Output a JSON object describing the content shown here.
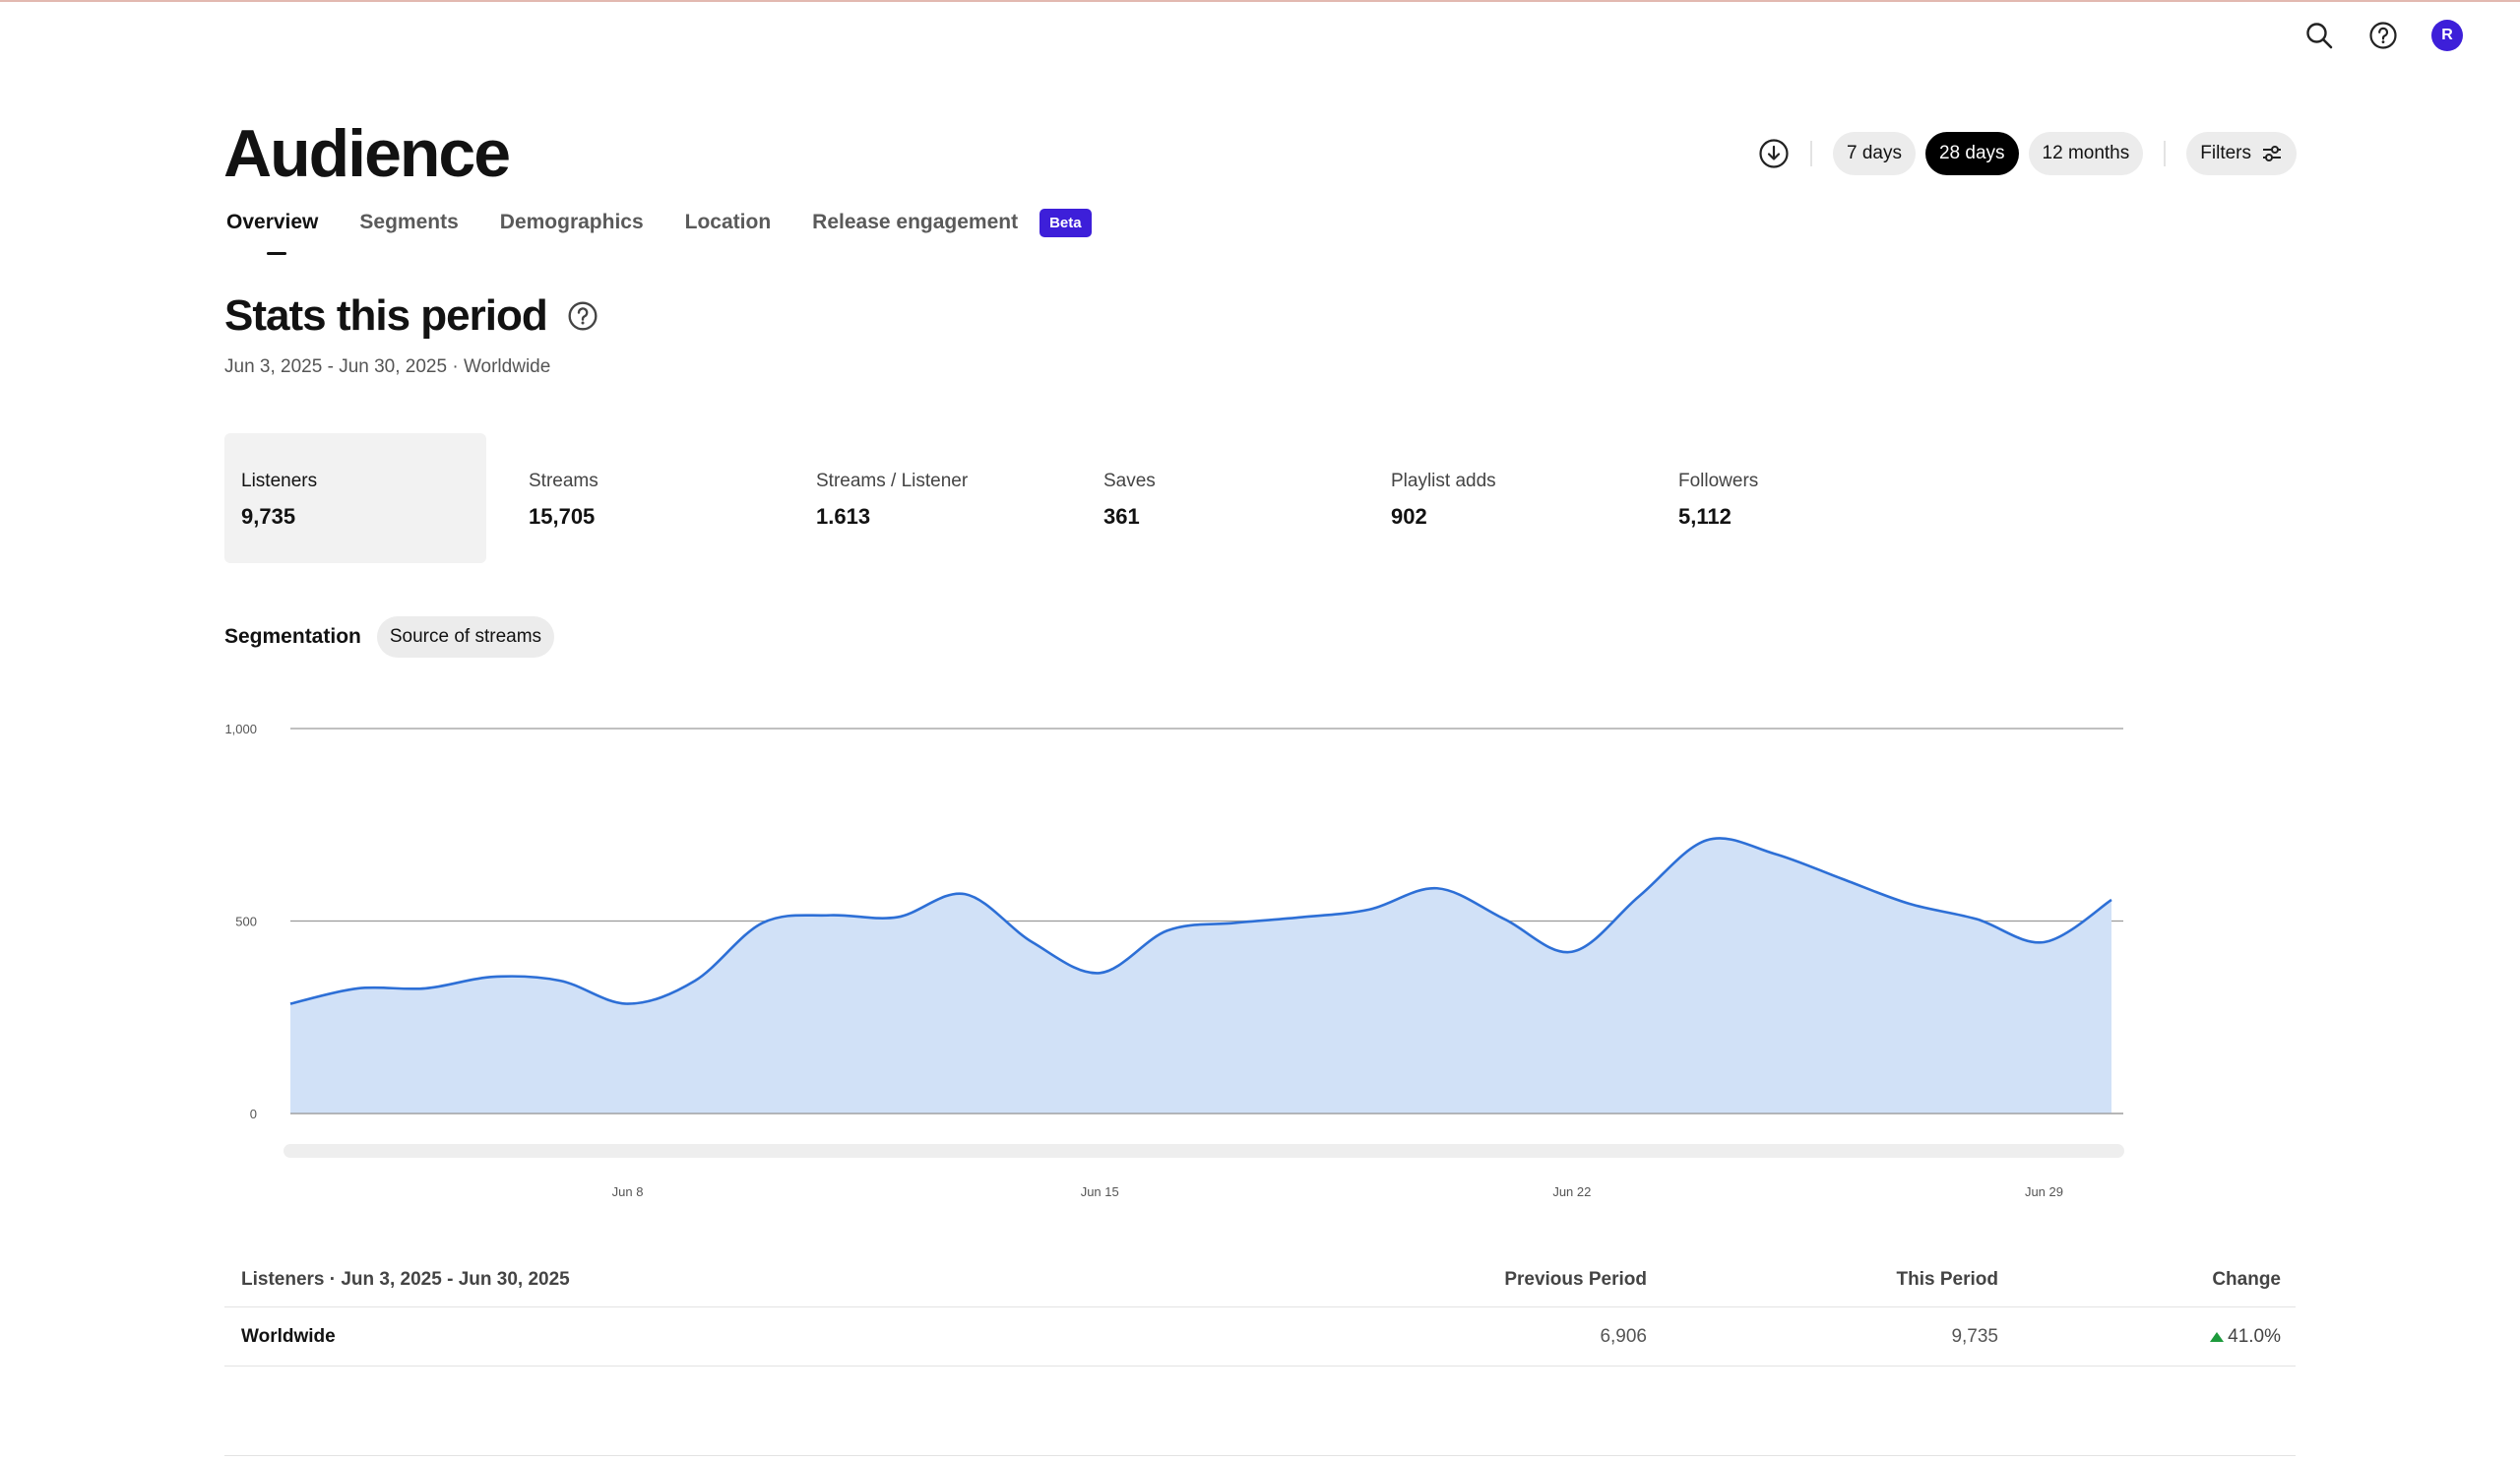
{
  "header": {
    "icons": [
      "search-icon",
      "help-icon"
    ],
    "avatar_initial": "R",
    "avatar_color": "#3d1fd9"
  },
  "page": {
    "title": "Audience"
  },
  "tabs": [
    {
      "label": "Overview",
      "active": true
    },
    {
      "label": "Segments",
      "active": false
    },
    {
      "label": "Demographics",
      "active": false
    },
    {
      "label": "Location",
      "active": false
    },
    {
      "label": "Release engagement",
      "active": false
    }
  ],
  "beta_badge": "Beta",
  "controls": {
    "download_icon": "download-icon",
    "periods": [
      "7 days",
      "28 days",
      "12 months"
    ],
    "active_period": "28 days",
    "filters_label": "Filters"
  },
  "stats_section": {
    "title": "Stats this period",
    "subtitle": "Jun 3, 2025 - Jun 30, 2025 · Worldwide"
  },
  "stats": [
    {
      "label": "Listeners",
      "value": "9,735",
      "selected": true
    },
    {
      "label": "Streams",
      "value": "15,705",
      "selected": false
    },
    {
      "label": "Streams / Listener",
      "value": "1.613",
      "selected": false
    },
    {
      "label": "Saves",
      "value": "361",
      "selected": false
    },
    {
      "label": "Playlist adds",
      "value": "902",
      "selected": false
    },
    {
      "label": "Followers",
      "value": "5,112",
      "selected": false
    }
  ],
  "segmentation": {
    "label": "Segmentation",
    "chip": "Source of streams"
  },
  "chart_data": {
    "type": "area",
    "title": "",
    "xlabel": "",
    "ylabel": "",
    "x": [
      "Jun 3",
      "Jun 4",
      "Jun 5",
      "Jun 6",
      "Jun 7",
      "Jun 8",
      "Jun 9",
      "Jun 10",
      "Jun 11",
      "Jun 12",
      "Jun 13",
      "Jun 14",
      "Jun 15",
      "Jun 16",
      "Jun 17",
      "Jun 18",
      "Jun 19",
      "Jun 20",
      "Jun 21",
      "Jun 22",
      "Jun 23",
      "Jun 24",
      "Jun 25",
      "Jun 26",
      "Jun 27",
      "Jun 28",
      "Jun 29",
      "Jun 30"
    ],
    "values": [
      285,
      325,
      325,
      355,
      345,
      285,
      345,
      495,
      515,
      510,
      570,
      445,
      365,
      475,
      495,
      510,
      530,
      585,
      505,
      420,
      565,
      710,
      675,
      610,
      545,
      505,
      445,
      555
    ],
    "ylim": [
      0,
      1000
    ],
    "yticks": [
      "0",
      "500",
      "1,000"
    ],
    "xticks": [
      "Jun 8",
      "Jun 15",
      "Jun 22",
      "Jun 29"
    ],
    "grid": true,
    "line_color": "#2d6fd6",
    "fill_color": "#d1e1f7"
  },
  "table": {
    "header": {
      "label": "Listeners · Jun 3, 2025 - Jun 30, 2025",
      "previous": "Previous Period",
      "current": "This Period",
      "change": "Change"
    },
    "rows": [
      {
        "name": "Worldwide",
        "previous": "6,906",
        "current": "9,735",
        "change": "41.0%",
        "direction": "up",
        "change_color": "#1d9a3c"
      }
    ]
  }
}
